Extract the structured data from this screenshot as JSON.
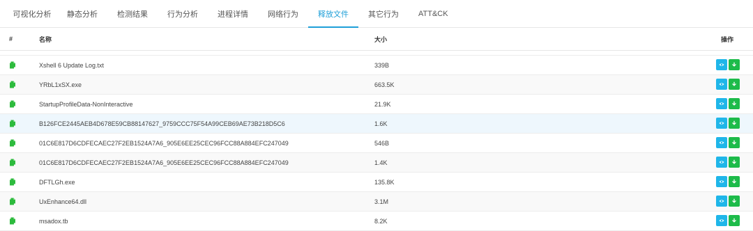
{
  "tabs": [
    {
      "label": "可视化分析"
    },
    {
      "label": "静态分析"
    },
    {
      "label": "检测结果"
    },
    {
      "label": "行为分析"
    },
    {
      "label": "进程详情"
    },
    {
      "label": "网络行为"
    },
    {
      "label": "释放文件",
      "active": true
    },
    {
      "label": "其它行为"
    },
    {
      "label": "ATT&CK"
    }
  ],
  "table": {
    "headers": {
      "index": "#",
      "name": "名称",
      "size": "大小",
      "actions": "操作"
    },
    "rows": [
      {
        "name": "Xshell 6 Update Log.txt",
        "size": "339B"
      },
      {
        "name": "YRbL1xSX.exe",
        "size": "663.5K"
      },
      {
        "name": "StartupProfileData-NonInteractive",
        "size": "21.9K"
      },
      {
        "name": "B126FCE2445AEB4D678E59CB88147627_9759CCC75F54A99CEB69AE73B218D5C6",
        "size": "1.6K"
      },
      {
        "name": "01C6E817D6CDFECAEC27F2EB1524A7A6_905E6EE25CEC96FCC88A884EFC247049",
        "size": "546B"
      },
      {
        "name": "01C6E817D6CDFECAEC27F2EB1524A7A6_905E6EE25CEC96FCC88A884EFC247049",
        "size": "1.4K"
      },
      {
        "name": "DFTLGh.exe",
        "size": "135.8K"
      },
      {
        "name": "UxEnhance64.dll",
        "size": "3.1M"
      },
      {
        "name": "msadox.tb",
        "size": "8.2K"
      }
    ]
  },
  "icons": {
    "file": "file-icon",
    "view": "eye-icon",
    "download": "download-icon"
  },
  "colors": {
    "accent": "#1e9fd8",
    "view_button": "#1fb6e9",
    "download_button": "#1dbb4a",
    "file_icon": "#2dbb3d"
  }
}
